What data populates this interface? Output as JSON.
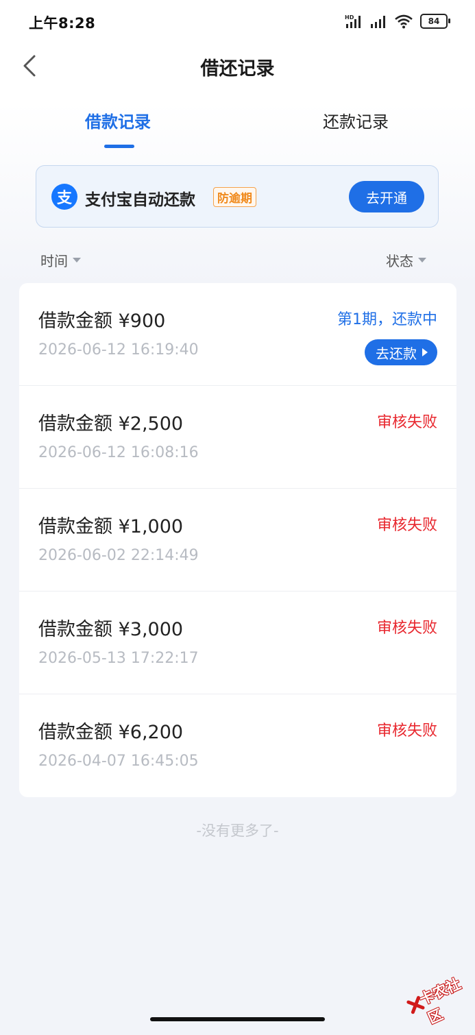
{
  "status_bar": {
    "time": "上午8:28",
    "battery": "84",
    "network_label": "HD"
  },
  "nav": {
    "title": "借还记录"
  },
  "tabs": [
    {
      "label": "借款记录",
      "active": true
    },
    {
      "label": "还款记录",
      "active": false
    }
  ],
  "banner": {
    "logo_char": "支",
    "text": "支付宝自动还款",
    "badge": "防逾期",
    "button": "去开通"
  },
  "filters": {
    "time": "时间",
    "status": "状态"
  },
  "records": [
    {
      "amount": "借款金额 ¥900",
      "date": "2026-06-12 16:19:40",
      "status": "第1期，还款中",
      "status_color": "#1f6fe6",
      "action": "去还款"
    },
    {
      "amount": "借款金额 ¥2,500",
      "date": "2026-06-12 16:08:16",
      "status": "审核失败",
      "status_color": "#e8272e"
    },
    {
      "amount": "借款金额 ¥1,000",
      "date": "2026-06-02 22:14:49",
      "status": "审核失败",
      "status_color": "#e8272e"
    },
    {
      "amount": "借款金额 ¥3,000",
      "date": "2026-05-13 17:22:17",
      "status": "审核失败",
      "status_color": "#e8272e"
    },
    {
      "amount": "借款金额 ¥6,200",
      "date": "2026-04-07 16:45:05",
      "status": "审核失败",
      "status_color": "#e8272e"
    }
  ],
  "footer": {
    "no_more": "-没有更多了-"
  },
  "watermark": {
    "text": "卡农社区"
  },
  "colors": {
    "accent": "#1f6fe6",
    "error": "#e8272e",
    "badge": "#f08a1c"
  }
}
